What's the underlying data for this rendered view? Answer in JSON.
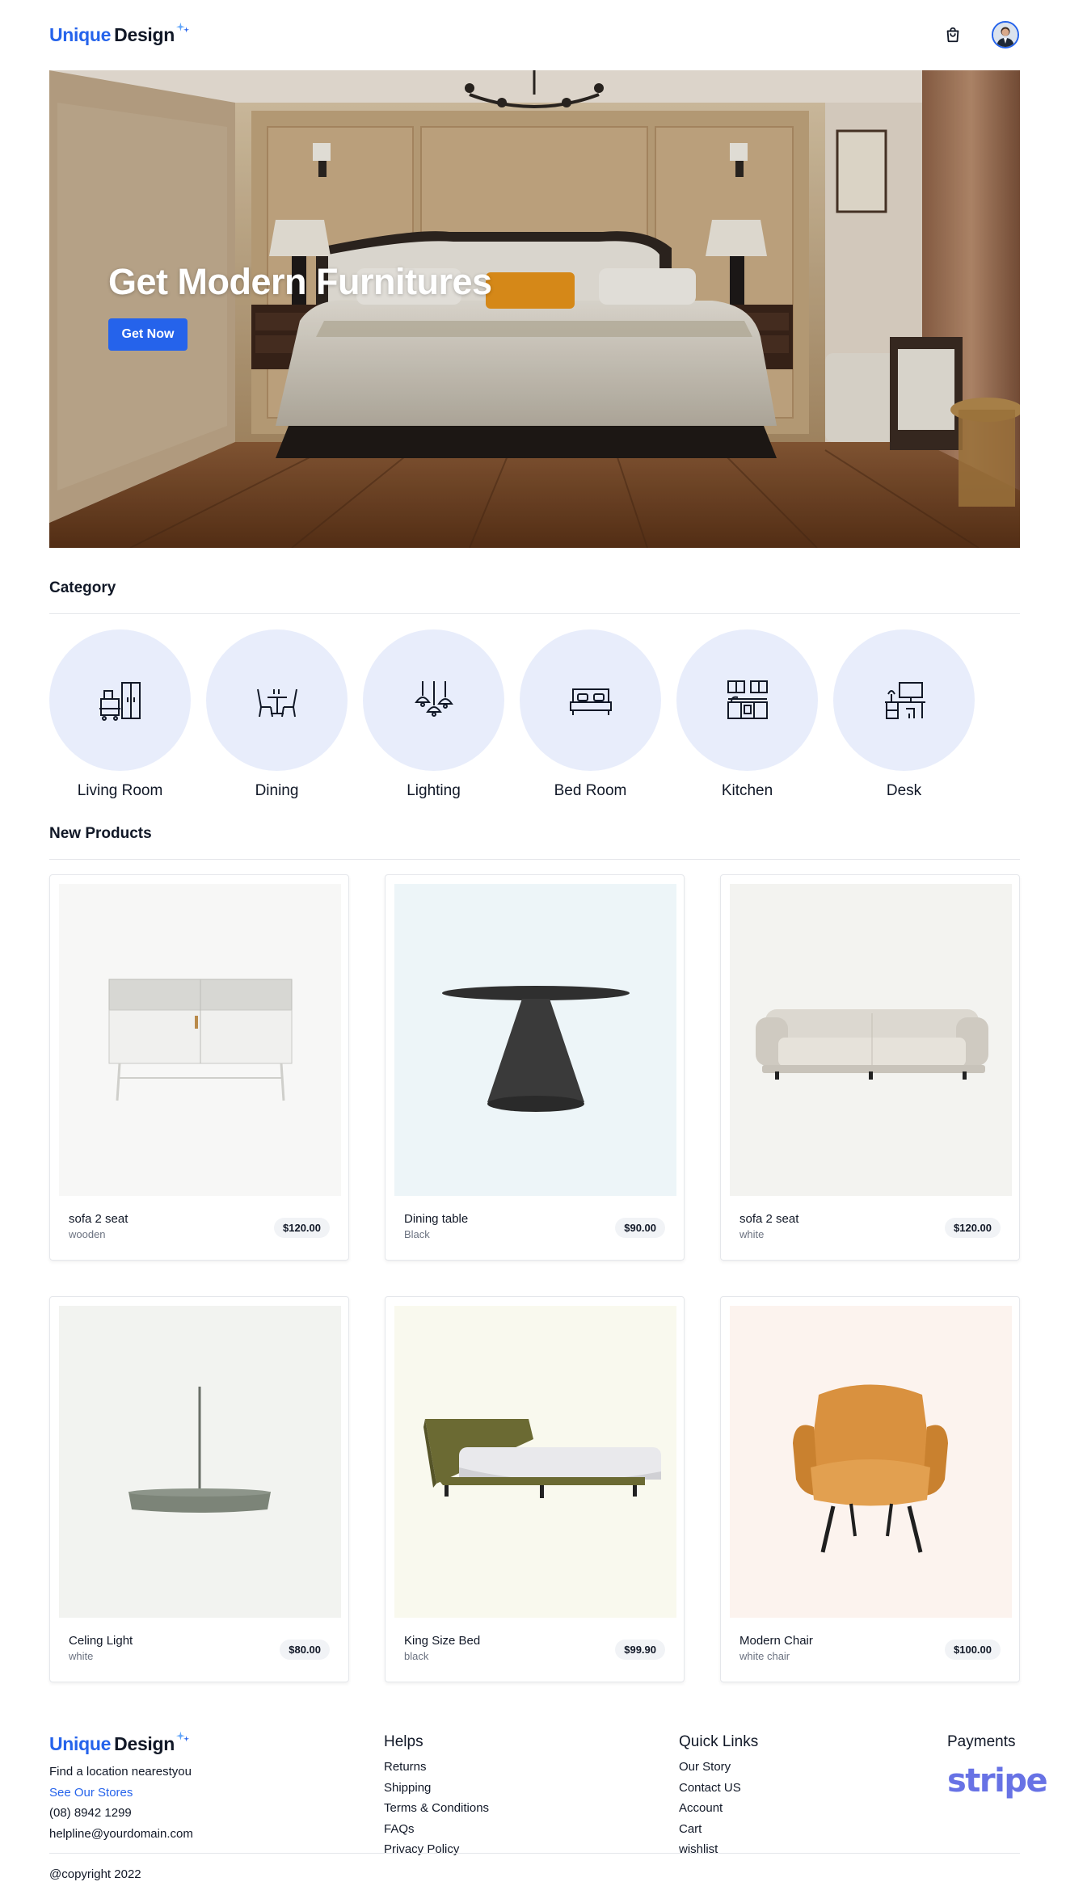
{
  "brand": {
    "name_part1": "Unique",
    "name_part2": "Design",
    "accent": "#2563eb"
  },
  "header": {
    "cart_icon": "shopping-bag-icon",
    "avatar_icon": "user-avatar"
  },
  "hero": {
    "title": "Get Modern Furnitures",
    "cta_label": "Get Now"
  },
  "categories": {
    "title": "Category",
    "items": [
      {
        "label": "Living Room",
        "icon": "living-room-icon"
      },
      {
        "label": "Dining",
        "icon": "dining-icon"
      },
      {
        "label": "Lighting",
        "icon": "lighting-icon"
      },
      {
        "label": "Bed Room",
        "icon": "bed-room-icon"
      },
      {
        "label": "Kitchen",
        "icon": "kitchen-icon"
      },
      {
        "label": "Desk",
        "icon": "desk-icon"
      }
    ]
  },
  "products": {
    "title": "New Products",
    "items": [
      {
        "name": "sofa 2 seat",
        "sub": "wooden",
        "price": "$120.00",
        "bg": "#f7f7f6"
      },
      {
        "name": "Dining table",
        "sub": "Black",
        "price": "$90.00",
        "bg": "#edf5f8"
      },
      {
        "name": "sofa 2 seat",
        "sub": "white",
        "price": "$120.00",
        "bg": "#f3f3f0"
      },
      {
        "name": "Celing Light",
        "sub": "white",
        "price": "$80.00",
        "bg": "#f2f3f0"
      },
      {
        "name": "King Size Bed",
        "sub": "black",
        "price": "$99.90",
        "bg": "#f9f9ee"
      },
      {
        "name": "Modern Chair",
        "sub": "white chair",
        "price": "$100.00",
        "bg": "#fcf3ee"
      }
    ]
  },
  "footer": {
    "brand": {
      "location_text": "Find a location nearestyou",
      "stores_link": "See Our Stores",
      "phone": "(08) 8942 1299",
      "email": "helpline@yourdomain.com"
    },
    "helps": {
      "title": "Helps",
      "links": [
        "Returns",
        "Shipping",
        "Terms & Conditions",
        "FAQs",
        "Privacy Policy"
      ]
    },
    "quick_links": {
      "title": "Quick Links",
      "links": [
        "Our Story",
        "Contact US",
        "Account",
        "Cart",
        "wishlist"
      ]
    },
    "payments": {
      "title": "Payments",
      "provider": "stripe",
      "provider_color": "#6772e5"
    },
    "copyright": "@copyright 2022"
  }
}
